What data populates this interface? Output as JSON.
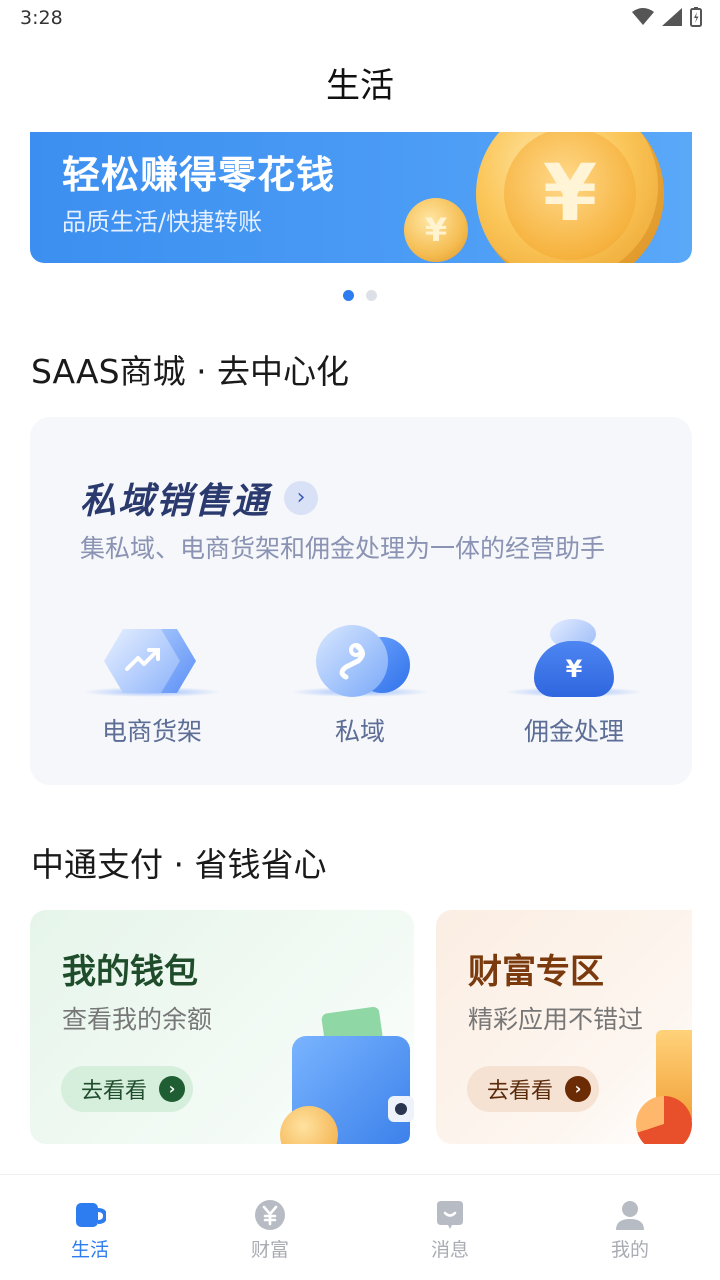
{
  "status_bar": {
    "time": "3:28"
  },
  "header": {
    "title": "生活"
  },
  "banner": {
    "title": "轻松赚得零花钱",
    "subtitle": "品质生活/快捷转账",
    "currency_symbol": "¥"
  },
  "carousel": {
    "count": 2,
    "active": 0
  },
  "sections": {
    "saas_heading": "SAAS商城 · 去中心化",
    "pay_heading": "中通支付 · 省钱省心"
  },
  "saas_card": {
    "title": "私域销售通",
    "arrow": "›",
    "description": "集私域、电商货架和佣金处理为一体的经营助手",
    "features": [
      {
        "label": "电商货架",
        "icon": "shelf-hexagon-icon"
      },
      {
        "label": "私域",
        "icon": "private-domain-link-icon"
      },
      {
        "label": "佣金处理",
        "icon": "commission-moneybag-icon"
      }
    ],
    "bag_symbol": "¥"
  },
  "promos": {
    "wallet": {
      "title": "我的钱包",
      "subtitle": "查看我的余额",
      "button": "去看看",
      "arrow": "›"
    },
    "wealth": {
      "title": "财富专区",
      "subtitle": "精彩应用不错过",
      "button": "去看看",
      "arrow": "›"
    }
  },
  "bottom_nav": {
    "items": [
      {
        "label": "生活",
        "icon": "life-cup-icon",
        "active": true
      },
      {
        "label": "财富",
        "icon": "wealth-yen-icon",
        "active": false
      },
      {
        "label": "消息",
        "icon": "message-bubble-icon",
        "active": false
      },
      {
        "label": "我的",
        "icon": "profile-person-icon",
        "active": false
      }
    ]
  },
  "colors": {
    "accent": "#2d7cf0",
    "banner": "#4a9bf5",
    "nav_inactive": "#a9acb3",
    "wallet_title": "#1f4d2b",
    "wealth_title": "#7a3a0e"
  }
}
